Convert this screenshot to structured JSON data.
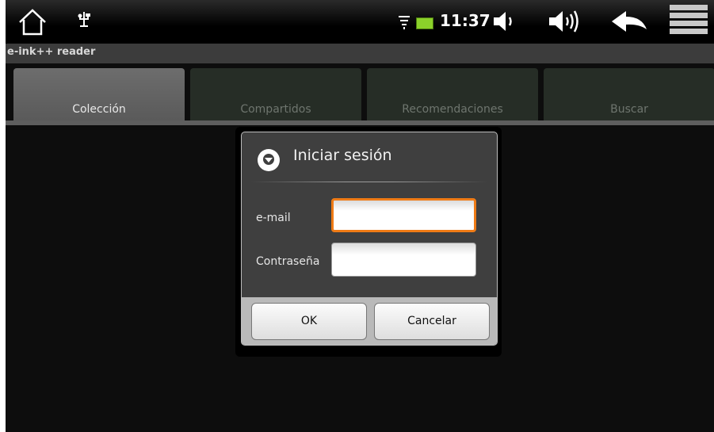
{
  "status_bar": {
    "time": "11:37",
    "icons": [
      "home-icon",
      "usb-icon",
      "wifi-icon",
      "battery-icon",
      "volume-down-icon",
      "volume-up-icon",
      "back-icon",
      "menu-icon"
    ]
  },
  "app": {
    "title": "e-ink++ reader"
  },
  "tabs": [
    {
      "label": "Colección",
      "active": true
    },
    {
      "label": "Compartidos",
      "active": false
    },
    {
      "label": "Recomendaciones",
      "active": false
    },
    {
      "label": "Buscar",
      "active": false
    }
  ],
  "dialog": {
    "title": "Iniciar sesión",
    "email_label": "e-mail",
    "email_value": "",
    "password_label": "Contraseña",
    "password_value": "",
    "ok_label": "OK",
    "cancel_label": "Cancelar"
  },
  "colors": {
    "focus": "#ef7b16",
    "battery": "#8bd12a"
  }
}
